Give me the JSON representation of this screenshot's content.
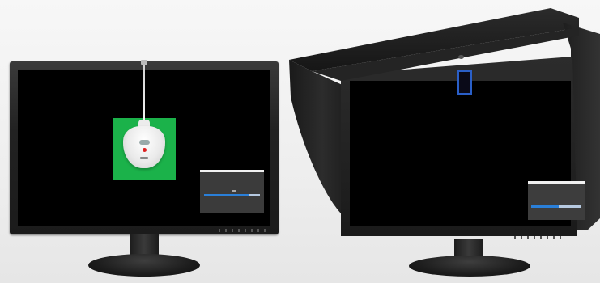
{
  "scene": {
    "background_color": "#f0f0f0",
    "accent_green": "#1bb24a",
    "progress_blue": "#2a7fd8",
    "left_dialog_progress": 0.8,
    "right_dialog_progress": 0.55
  },
  "left_monitor": {
    "screen_content": [
      "green-calibration-patch",
      "calibration-sensor",
      "progress-dialog"
    ]
  },
  "right_monitor": {
    "accessory": "shading-hood",
    "screen_content": [
      "built-in-sensor",
      "progress-dialog"
    ]
  }
}
